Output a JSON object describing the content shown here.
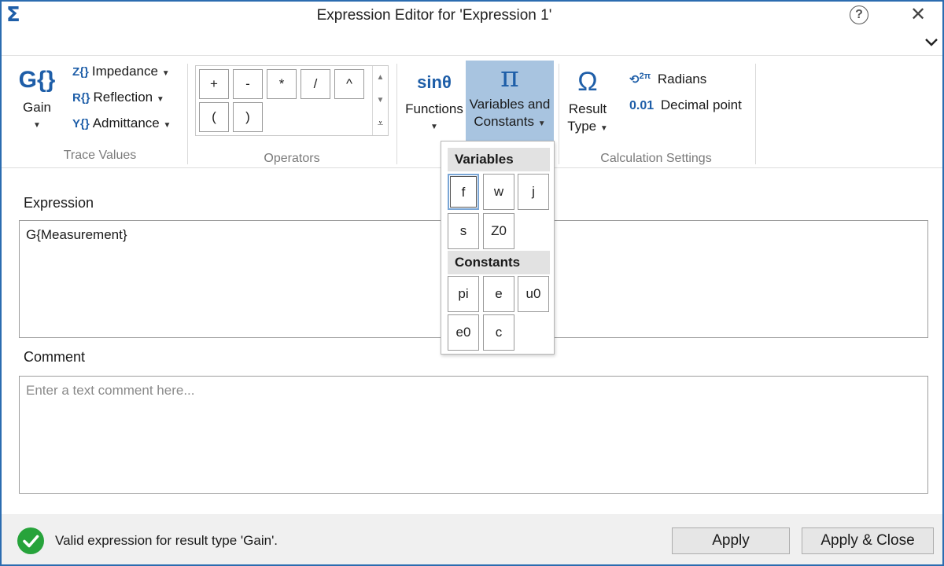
{
  "window": {
    "title": "Expression Editor for 'Expression 1'",
    "app_icon": "sigma-icon",
    "help_icon": "help-icon",
    "close_icon": "close-icon"
  },
  "ribbon": {
    "trace_values": {
      "gain": {
        "icon_text": "G{}",
        "label": "Gain"
      },
      "impedance": {
        "icon_text": "Z{}",
        "label": "Impedance"
      },
      "reflection": {
        "icon_text": "R{}",
        "label": "Reflection"
      },
      "admittance": {
        "icon_text": "Y{}",
        "label": "Admittance"
      },
      "group_label": "Trace Values"
    },
    "operators": {
      "row1": [
        "+",
        "-",
        "*",
        "/",
        "^"
      ],
      "row2": [
        "(",
        ")"
      ],
      "group_label": "Operators"
    },
    "functions": {
      "icon_text": "sinθ",
      "label": "Functions"
    },
    "variables_constants": {
      "icon_text": "π",
      "label_line1": "Variables and",
      "label_line2": "Constants"
    },
    "calculation_settings": {
      "result_type": {
        "icon_text": "Ω",
        "label_line1": "Result",
        "label_line2": "Type"
      },
      "radians": {
        "icon_text": "2π",
        "label": "Radians"
      },
      "decimal_point": {
        "icon_text": "0.01",
        "label": "Decimal point"
      },
      "group_label": "Calculation Settings"
    }
  },
  "main": {
    "expression_label": "Expression",
    "expression_value": "G{Measurement}",
    "comment_label": "Comment",
    "comment_placeholder": "Enter a text comment here..."
  },
  "popup": {
    "variables_header": "Variables",
    "variables": [
      "f",
      "w",
      "j",
      "s",
      "Z0"
    ],
    "constants_header": "Constants",
    "constants": [
      "pi",
      "e",
      "u0",
      "e0",
      "c"
    ]
  },
  "status": {
    "message": "Valid expression for result type 'Gain'.",
    "status_color": "#27a33b"
  },
  "buttons": {
    "apply": "Apply",
    "apply_close": "Apply & Close"
  },
  "colors": {
    "accent": "#1e5ea8",
    "active_button": "#a8c4e0"
  }
}
